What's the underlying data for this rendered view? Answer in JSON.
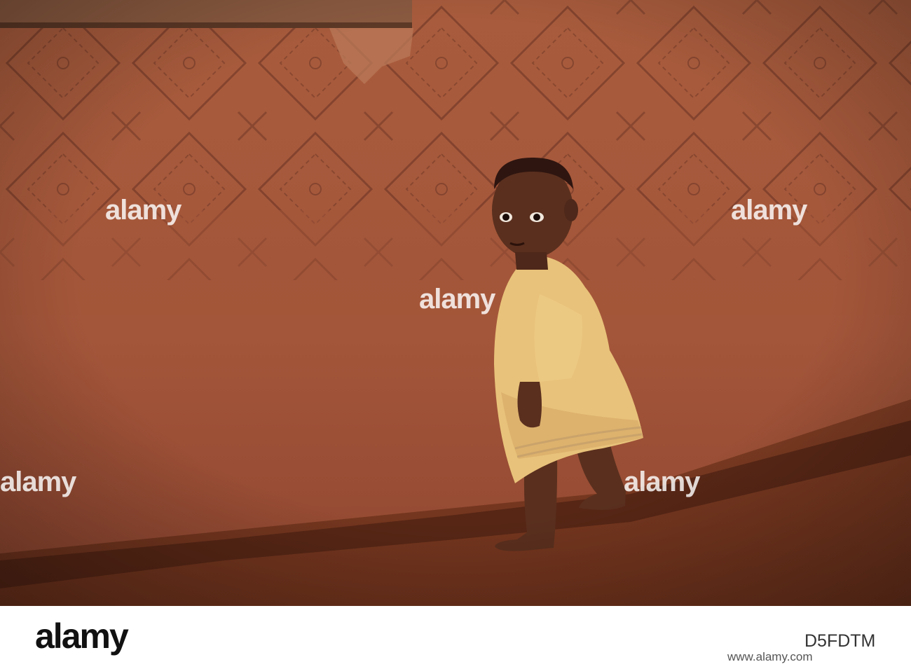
{
  "watermark": {
    "text": "alamy"
  },
  "footer": {
    "logo": "alamy",
    "image_id": "D5FDTM",
    "url": "www.alamy.com"
  },
  "colors": {
    "wall": "#a4563a",
    "ground": "#7a3a22",
    "shirt": "#e8c27a",
    "skin": "#5a2f1e"
  }
}
